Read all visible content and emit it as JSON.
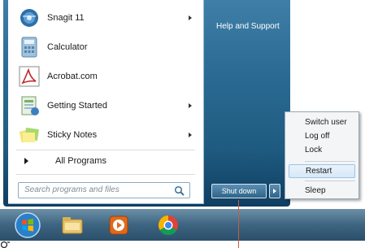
{
  "start_menu": {
    "programs": [
      {
        "label": "Snagit 11",
        "icon": "snagit-icon",
        "has_submenu": true
      },
      {
        "label": "Calculator",
        "icon": "calculator-icon",
        "has_submenu": false
      },
      {
        "label": "Acrobat.com",
        "icon": "acrobat-icon",
        "has_submenu": false
      },
      {
        "label": "Getting Started",
        "icon": "getting-started-icon",
        "has_submenu": true
      },
      {
        "label": "Sticky Notes",
        "icon": "sticky-notes-icon",
        "has_submenu": true
      }
    ],
    "all_programs_label": "All Programs",
    "search_placeholder": "Search programs and files",
    "right_panel": {
      "help_label": "Help and Support"
    },
    "shutdown_label": "Shut down"
  },
  "shutdown_menu": {
    "items": [
      {
        "label": "Switch user"
      },
      {
        "label": "Log off"
      },
      {
        "label": "Lock"
      },
      {
        "label": "Restart",
        "highlighted": true
      },
      {
        "label": "Sleep"
      }
    ]
  },
  "taskbar": {
    "items": [
      "start-orb-icon",
      "explorer-icon",
      "media-player-icon",
      "chrome-icon"
    ]
  },
  "colors": {
    "menu_blue": "#2a6a92",
    "highlight": "#d6e8f7",
    "pointer": "#c95c3f"
  }
}
